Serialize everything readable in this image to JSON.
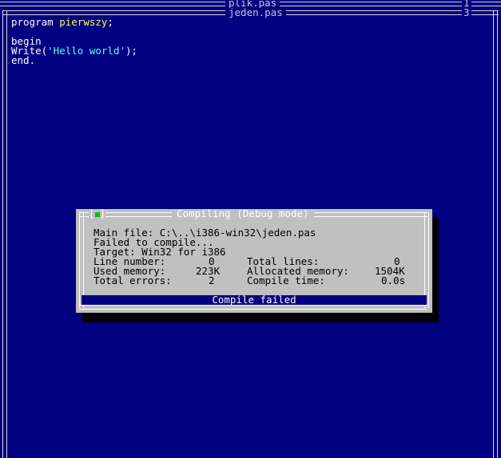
{
  "windows": {
    "back": {
      "title": "plik.pas",
      "number": "1"
    },
    "front": {
      "title": "jeden.pas",
      "number": "3"
    }
  },
  "editor": {
    "lines": [
      {
        "parts": [
          {
            "t": "program ",
            "c": "kw"
          },
          {
            "t": "pierwszy",
            "c": "id"
          },
          {
            "t": ";",
            "c": "kw"
          }
        ]
      },
      {
        "parts": []
      },
      {
        "parts": [
          {
            "t": "begin",
            "c": "kw"
          }
        ]
      },
      {
        "parts": [
          {
            "t": "Write(",
            "c": "kw"
          },
          {
            "t": "'Hello world'",
            "c": "str"
          },
          {
            "t": ");",
            "c": "kw"
          }
        ]
      },
      {
        "parts": [
          {
            "t": "end.",
            "c": "kw"
          }
        ]
      }
    ]
  },
  "dialog": {
    "title": "Compiling  (Debug mode)",
    "close_label": "[",
    "close_label_end": "]",
    "main_file": "Main file: C:\\..\\i386-win32\\jeden.pas",
    "failed": "Failed to compile...",
    "target": "Target: Win32 for i386",
    "line_number_label": "Line number:",
    "line_number_value": "0",
    "total_lines_label": "Total lines:",
    "total_lines_value": "0",
    "used_memory_label": "Used memory:",
    "used_memory_value": "223K",
    "allocated_memory_label": "Allocated memory:",
    "allocated_memory_value": "1504K",
    "total_errors_label": "Total errors:",
    "total_errors_value": "2",
    "compile_time_label": "Compile time:",
    "compile_time_value": "0.0s",
    "status": "Compile failed"
  }
}
